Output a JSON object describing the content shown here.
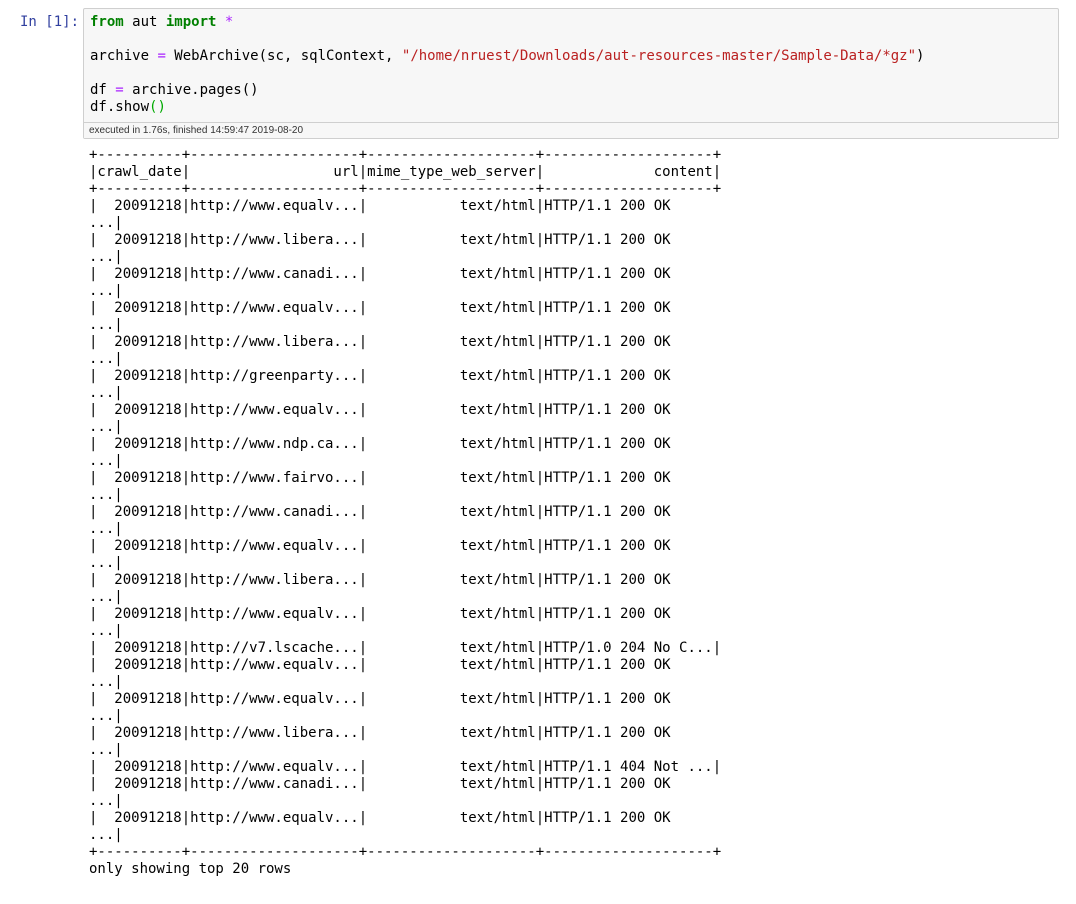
{
  "cell": {
    "prompt": "In [1]:",
    "code": {
      "line1_from": "from",
      "line1_module": " aut ",
      "line1_import": "import",
      "line1_star": " *",
      "line3_var": "archive ",
      "line3_eq": "=",
      "line3_call": " WebArchive(sc, sqlContext, ",
      "line3_path": "\"/home/nruest/Downloads/aut-resources-master/Sample-Data/*gz\"",
      "line3_close": ")",
      "line5_var": "df ",
      "line5_eq": "=",
      "line5_call": " archive.pages()",
      "line6_call": "df.show",
      "line6_parens": "()"
    },
    "execution_info": "executed in 1.76s, finished 14:59:47 2019-08-20"
  },
  "output": {
    "lines": [
      "+----------+--------------------+--------------------+--------------------+",
      "|crawl_date|                 url|mime_type_web_server|             content|",
      "+----------+--------------------+--------------------+--------------------+",
      "|  20091218|http://www.equalv...|           text/html|HTTP/1.1 200 OK",
      "...|",
      "|  20091218|http://www.libera...|           text/html|HTTP/1.1 200 OK",
      "...|",
      "|  20091218|http://www.canadi...|           text/html|HTTP/1.1 200 OK",
      "...|",
      "|  20091218|http://www.equalv...|           text/html|HTTP/1.1 200 OK",
      "...|",
      "|  20091218|http://www.libera...|           text/html|HTTP/1.1 200 OK",
      "...|",
      "|  20091218|http://greenparty...|           text/html|HTTP/1.1 200 OK",
      "...|",
      "|  20091218|http://www.equalv...|           text/html|HTTP/1.1 200 OK",
      "...|",
      "|  20091218|http://www.ndp.ca...|           text/html|HTTP/1.1 200 OK",
      "...|",
      "|  20091218|http://www.fairvo...|           text/html|HTTP/1.1 200 OK",
      "...|",
      "|  20091218|http://www.canadi...|           text/html|HTTP/1.1 200 OK",
      "...|",
      "|  20091218|http://www.equalv...|           text/html|HTTP/1.1 200 OK",
      "...|",
      "|  20091218|http://www.libera...|           text/html|HTTP/1.1 200 OK",
      "...|",
      "|  20091218|http://www.equalv...|           text/html|HTTP/1.1 200 OK",
      "...|",
      "|  20091218|http://v7.lscache...|           text/html|HTTP/1.0 204 No C...|",
      "|  20091218|http://www.equalv...|           text/html|HTTP/1.1 200 OK",
      "...|",
      "|  20091218|http://www.equalv...|           text/html|HTTP/1.1 200 OK",
      "...|",
      "|  20091218|http://www.libera...|           text/html|HTTP/1.1 200 OK",
      "...|",
      "|  20091218|http://www.equalv...|           text/html|HTTP/1.1 404 Not ...|",
      "|  20091218|http://www.canadi...|           text/html|HTTP/1.1 200 OK",
      "...|",
      "|  20091218|http://www.equalv...|           text/html|HTTP/1.1 200 OK",
      "...|",
      "+----------+--------------------+--------------------+--------------------+",
      "only showing top 20 rows"
    ]
  },
  "colors": {
    "prompt": "#303f9f",
    "keyword": "#008000",
    "operator": "#aa22ff",
    "string": "#ba2121",
    "cell_background": "#f7f7f7",
    "cell_border": "#cfcfcf"
  }
}
